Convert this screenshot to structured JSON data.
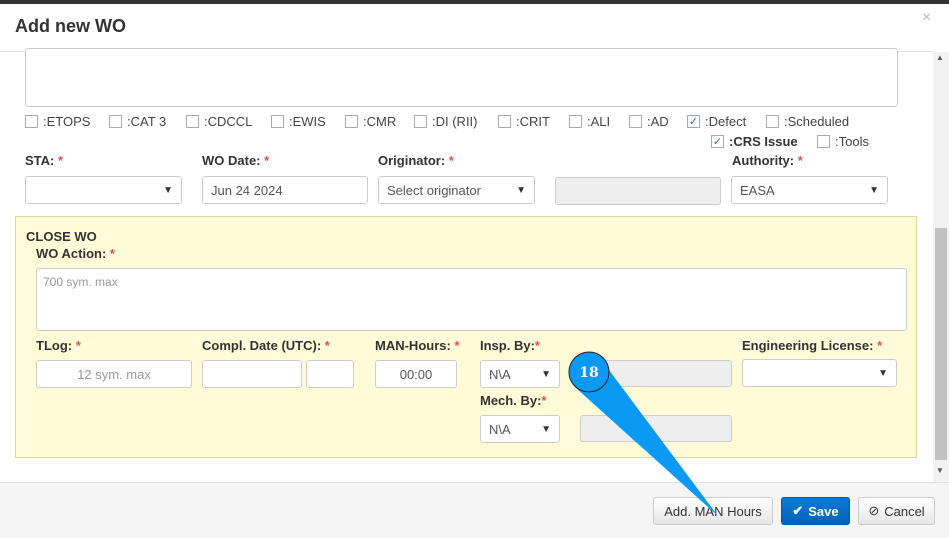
{
  "dialog": {
    "title": "Add new WO",
    "close": "×"
  },
  "flags": [
    {
      "label": ":ETOPS",
      "checked": false
    },
    {
      "label": ":CAT 3",
      "checked": false
    },
    {
      "label": ":CDCCL",
      "checked": false
    },
    {
      "label": ":EWIS",
      "checked": false
    },
    {
      "label": ":CMR",
      "checked": false
    },
    {
      "label": ":DI (RII)",
      "checked": false
    },
    {
      "label": ":CRIT",
      "checked": false
    },
    {
      "label": ":ALI",
      "checked": false
    },
    {
      "label": ":AD",
      "checked": false
    },
    {
      "label": ":Defect",
      "checked": true
    },
    {
      "label": ":Scheduled",
      "checked": false
    },
    {
      "label": ":CRS Issue",
      "checked": true
    },
    {
      "label": ":Tools",
      "checked": false
    }
  ],
  "fields": {
    "sta": {
      "label": "STA:",
      "value": ""
    },
    "wo_date": {
      "label": "WO Date:",
      "value": "Jun 24 2024"
    },
    "originator": {
      "label": "Originator:",
      "value": "Select originator"
    },
    "authority": {
      "label": "Authority:",
      "value": "EASA"
    }
  },
  "close_wo": {
    "title": "CLOSE WO",
    "wo_action": {
      "label": "WO Action:",
      "placeholder": "700 sym. max"
    },
    "tlog": {
      "label": "TLog:",
      "placeholder": "12 sym. max"
    },
    "compl_date": {
      "label": "Compl. Date (UTC):"
    },
    "man_hours": {
      "label": "MAN-Hours:",
      "value": "00:00"
    },
    "insp_by": {
      "label": "Insp. By:",
      "value": "N\\A"
    },
    "mech_by": {
      "label": "Mech. By:",
      "value": "N\\A"
    },
    "eng_license": {
      "label": "Engineering License:",
      "value": ""
    }
  },
  "required_mark": "*",
  "footer": {
    "add_man_hours": "Add. MAN Hours",
    "save": "Save",
    "cancel": "Cancel"
  },
  "callout": {
    "number": "18",
    "color": "#0a9af5"
  }
}
